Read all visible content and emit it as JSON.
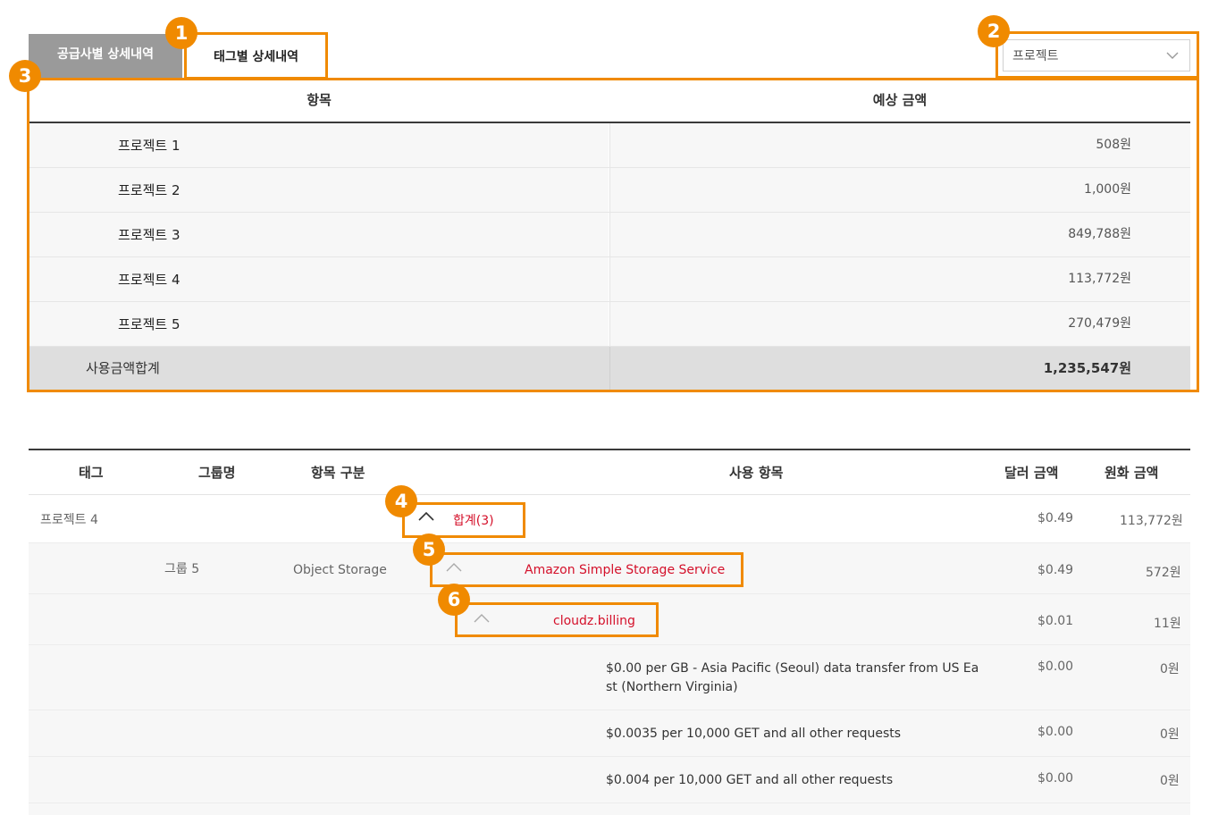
{
  "tabs": {
    "supplier_label": "공급사별 상세내역",
    "tag_label": "태그별 상세내역"
  },
  "filter": {
    "selected": "프로젝트",
    "icon": "chevron-down-icon"
  },
  "annotations": [
    "1",
    "2",
    "3",
    "4",
    "5",
    "6"
  ],
  "summary": {
    "headers": {
      "item": "항목",
      "amount": "예상 금액"
    },
    "rows": [
      {
        "name": "프로젝트 1",
        "amount": "508원"
      },
      {
        "name": "프로젝트 2",
        "amount": "1,000원"
      },
      {
        "name": "프로젝트 3",
        "amount": "849,788원"
      },
      {
        "name": "프로젝트 4",
        "amount": "113,772원"
      },
      {
        "name": "프로젝트 5",
        "amount": "270,479원"
      }
    ],
    "total": {
      "label": "사용금액합계",
      "amount": "1,235,547원"
    }
  },
  "detail": {
    "headers": {
      "tag": "태그",
      "group": "그룹명",
      "category": "항목 구분",
      "usage": "사용 항목",
      "usd": "달러 금액",
      "krw": "원화 금액"
    },
    "tag_row": {
      "tag": "프로젝트 4",
      "usage": "합계(3)",
      "usd": "$0.49",
      "krw": "113,772원"
    },
    "service_row": {
      "group": "그룹 5",
      "category": "Object Storage",
      "usage": "Amazon Simple Storage Service",
      "usd": "$0.49",
      "krw": "572원"
    },
    "billing_row": {
      "usage": "cloudz.billing",
      "usd": "$0.01",
      "krw": "11원"
    },
    "items": [
      {
        "line1": "$0.00 per GB - Asia Pacific (Seoul) data transfer from US Ea",
        "line2": "st (Northern Virginia)",
        "usd": "$0.00",
        "krw": "0원"
      },
      {
        "line1": "$0.0035 per 10,000 GET and all other requests",
        "usd": "$0.00",
        "krw": "0원"
      },
      {
        "line1": "$0.004 per 10,000 GET and all other requests",
        "usd": "$0.00",
        "krw": "0원"
      }
    ]
  }
}
